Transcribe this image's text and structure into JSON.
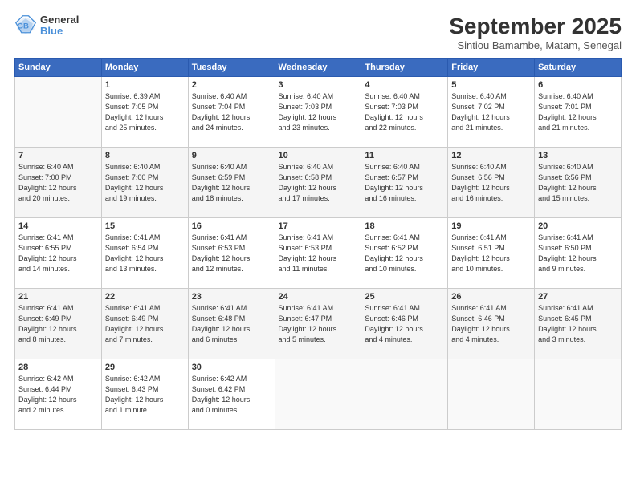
{
  "header": {
    "logo_line1": "General",
    "logo_line2": "Blue",
    "month": "September 2025",
    "location": "Sintiou Bamambe, Matam, Senegal"
  },
  "weekdays": [
    "Sunday",
    "Monday",
    "Tuesday",
    "Wednesday",
    "Thursday",
    "Friday",
    "Saturday"
  ],
  "weeks": [
    [
      {
        "day": "",
        "info": ""
      },
      {
        "day": "1",
        "info": "Sunrise: 6:39 AM\nSunset: 7:05 PM\nDaylight: 12 hours\nand 25 minutes."
      },
      {
        "day": "2",
        "info": "Sunrise: 6:40 AM\nSunset: 7:04 PM\nDaylight: 12 hours\nand 24 minutes."
      },
      {
        "day": "3",
        "info": "Sunrise: 6:40 AM\nSunset: 7:03 PM\nDaylight: 12 hours\nand 23 minutes."
      },
      {
        "day": "4",
        "info": "Sunrise: 6:40 AM\nSunset: 7:03 PM\nDaylight: 12 hours\nand 22 minutes."
      },
      {
        "day": "5",
        "info": "Sunrise: 6:40 AM\nSunset: 7:02 PM\nDaylight: 12 hours\nand 21 minutes."
      },
      {
        "day": "6",
        "info": "Sunrise: 6:40 AM\nSunset: 7:01 PM\nDaylight: 12 hours\nand 21 minutes."
      }
    ],
    [
      {
        "day": "7",
        "info": "Sunrise: 6:40 AM\nSunset: 7:00 PM\nDaylight: 12 hours\nand 20 minutes."
      },
      {
        "day": "8",
        "info": "Sunrise: 6:40 AM\nSunset: 7:00 PM\nDaylight: 12 hours\nand 19 minutes."
      },
      {
        "day": "9",
        "info": "Sunrise: 6:40 AM\nSunset: 6:59 PM\nDaylight: 12 hours\nand 18 minutes."
      },
      {
        "day": "10",
        "info": "Sunrise: 6:40 AM\nSunset: 6:58 PM\nDaylight: 12 hours\nand 17 minutes."
      },
      {
        "day": "11",
        "info": "Sunrise: 6:40 AM\nSunset: 6:57 PM\nDaylight: 12 hours\nand 16 minutes."
      },
      {
        "day": "12",
        "info": "Sunrise: 6:40 AM\nSunset: 6:56 PM\nDaylight: 12 hours\nand 16 minutes."
      },
      {
        "day": "13",
        "info": "Sunrise: 6:40 AM\nSunset: 6:56 PM\nDaylight: 12 hours\nand 15 minutes."
      }
    ],
    [
      {
        "day": "14",
        "info": "Sunrise: 6:41 AM\nSunset: 6:55 PM\nDaylight: 12 hours\nand 14 minutes."
      },
      {
        "day": "15",
        "info": "Sunrise: 6:41 AM\nSunset: 6:54 PM\nDaylight: 12 hours\nand 13 minutes."
      },
      {
        "day": "16",
        "info": "Sunrise: 6:41 AM\nSunset: 6:53 PM\nDaylight: 12 hours\nand 12 minutes."
      },
      {
        "day": "17",
        "info": "Sunrise: 6:41 AM\nSunset: 6:53 PM\nDaylight: 12 hours\nand 11 minutes."
      },
      {
        "day": "18",
        "info": "Sunrise: 6:41 AM\nSunset: 6:52 PM\nDaylight: 12 hours\nand 10 minutes."
      },
      {
        "day": "19",
        "info": "Sunrise: 6:41 AM\nSunset: 6:51 PM\nDaylight: 12 hours\nand 10 minutes."
      },
      {
        "day": "20",
        "info": "Sunrise: 6:41 AM\nSunset: 6:50 PM\nDaylight: 12 hours\nand 9 minutes."
      }
    ],
    [
      {
        "day": "21",
        "info": "Sunrise: 6:41 AM\nSunset: 6:49 PM\nDaylight: 12 hours\nand 8 minutes."
      },
      {
        "day": "22",
        "info": "Sunrise: 6:41 AM\nSunset: 6:49 PM\nDaylight: 12 hours\nand 7 minutes."
      },
      {
        "day": "23",
        "info": "Sunrise: 6:41 AM\nSunset: 6:48 PM\nDaylight: 12 hours\nand 6 minutes."
      },
      {
        "day": "24",
        "info": "Sunrise: 6:41 AM\nSunset: 6:47 PM\nDaylight: 12 hours\nand 5 minutes."
      },
      {
        "day": "25",
        "info": "Sunrise: 6:41 AM\nSunset: 6:46 PM\nDaylight: 12 hours\nand 4 minutes."
      },
      {
        "day": "26",
        "info": "Sunrise: 6:41 AM\nSunset: 6:46 PM\nDaylight: 12 hours\nand 4 minutes."
      },
      {
        "day": "27",
        "info": "Sunrise: 6:41 AM\nSunset: 6:45 PM\nDaylight: 12 hours\nand 3 minutes."
      }
    ],
    [
      {
        "day": "28",
        "info": "Sunrise: 6:42 AM\nSunset: 6:44 PM\nDaylight: 12 hours\nand 2 minutes."
      },
      {
        "day": "29",
        "info": "Sunrise: 6:42 AM\nSunset: 6:43 PM\nDaylight: 12 hours\nand 1 minute."
      },
      {
        "day": "30",
        "info": "Sunrise: 6:42 AM\nSunset: 6:42 PM\nDaylight: 12 hours\nand 0 minutes."
      },
      {
        "day": "",
        "info": ""
      },
      {
        "day": "",
        "info": ""
      },
      {
        "day": "",
        "info": ""
      },
      {
        "day": "",
        "info": ""
      }
    ]
  ]
}
